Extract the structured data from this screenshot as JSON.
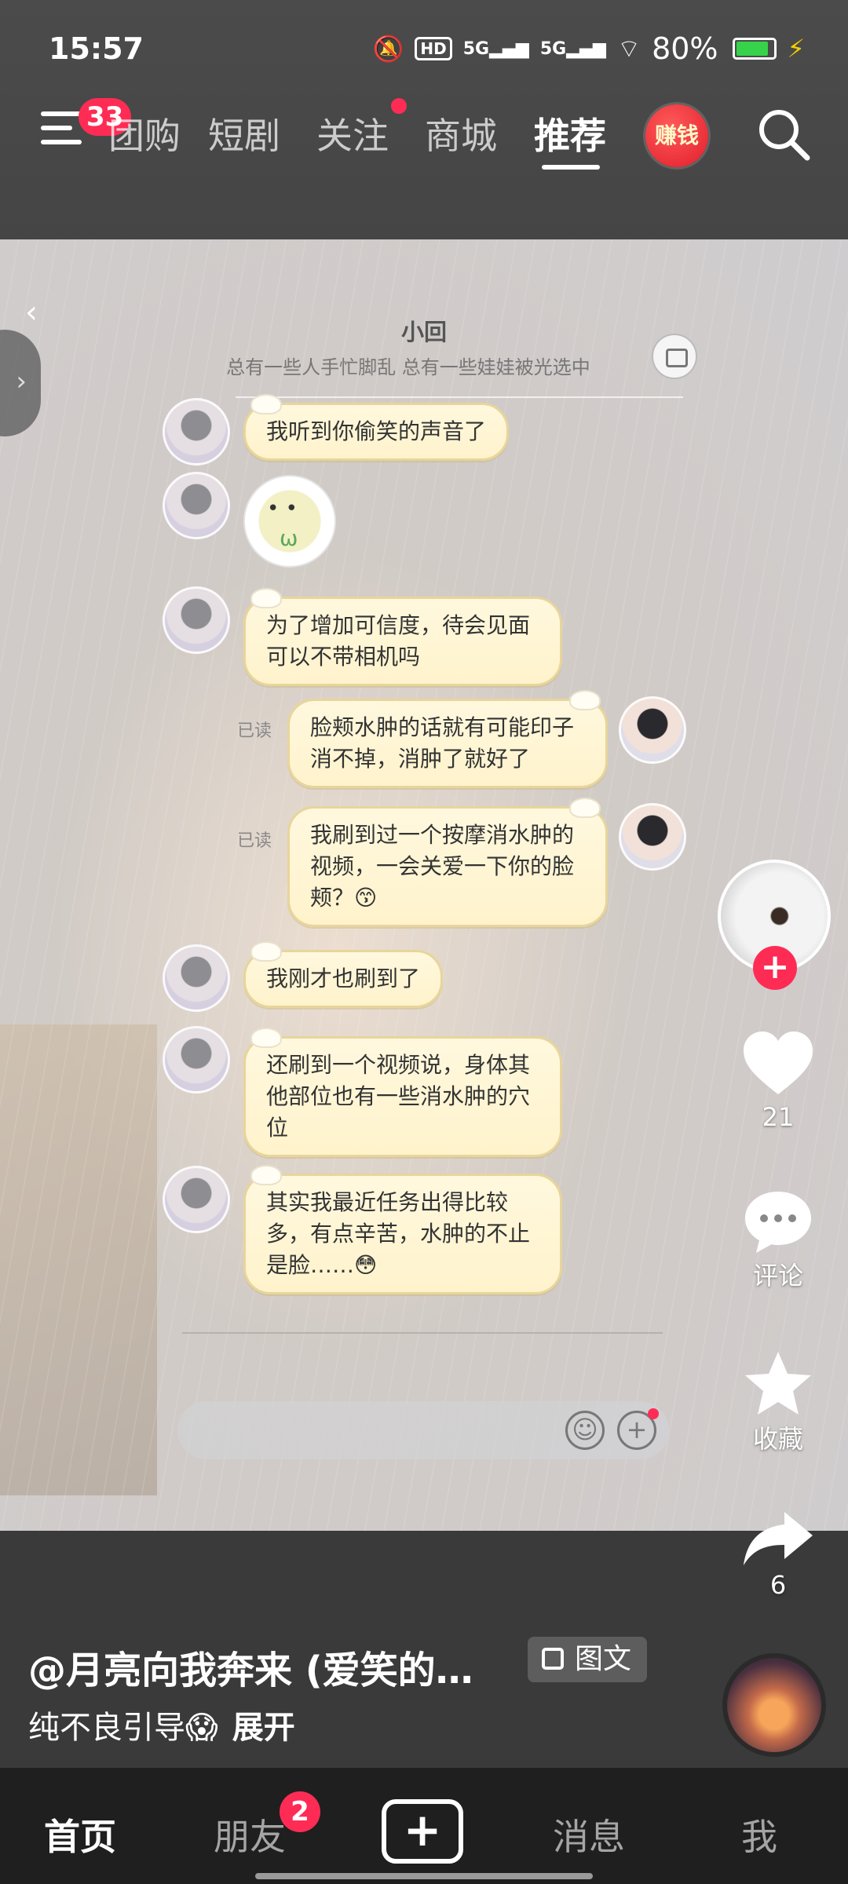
{
  "status_bar": {
    "time": "15:57",
    "hd_label": "HD",
    "network_1": "5G",
    "network_2": "5G",
    "battery": "80%"
  },
  "top_nav": {
    "menu_badge": "33",
    "tabs": [
      {
        "label": "团购",
        "partial": true
      },
      {
        "label": "短剧"
      },
      {
        "label": "关注",
        "has_dot": true
      },
      {
        "label": "商城"
      },
      {
        "label": "推荐",
        "active": true
      }
    ],
    "earn_label": "赚钱",
    "colors": {
      "accent": "#fe2c55"
    }
  },
  "chat": {
    "title": "小回",
    "subtitle": "总有一些人手忙脚乱 总有一些娃娃被光选中",
    "messages": [
      {
        "side": "left",
        "text": "我听到你偷笑的声音了"
      },
      {
        "side": "left",
        "type": "sticker"
      },
      {
        "side": "left",
        "text": "为了增加可信度，待会见面可以不带相机吗"
      },
      {
        "side": "right",
        "read": "已读",
        "text": "脸颊水肿的话就有可能印子消不掉，消肿了就好了"
      },
      {
        "side": "right",
        "read": "已读",
        "text": "我刷到过一个按摩消水肿的视频，一会关爱一下你的脸颊？😙"
      },
      {
        "side": "left",
        "text": "我刚才也刷到了"
      },
      {
        "side": "left",
        "text": "还刷到一个视频说，身体其他部位也有一些消水肿的穴位"
      },
      {
        "side": "left",
        "text": "其实我最近任务出得比较多，有点辛苦，水肿的不止是脸……😳"
      }
    ]
  },
  "actions": {
    "likes": "21",
    "comment_label": "评论",
    "favorite_label": "收藏",
    "shares": "6"
  },
  "caption": {
    "author": "@月亮向我奔来 (爱笑的…",
    "tag": "图文",
    "text": "纯不良引导😱",
    "expand": "展开"
  },
  "bottom_nav": {
    "home": "首页",
    "friends": "朋友",
    "friends_badge": "2",
    "messages": "消息",
    "me": "我"
  }
}
